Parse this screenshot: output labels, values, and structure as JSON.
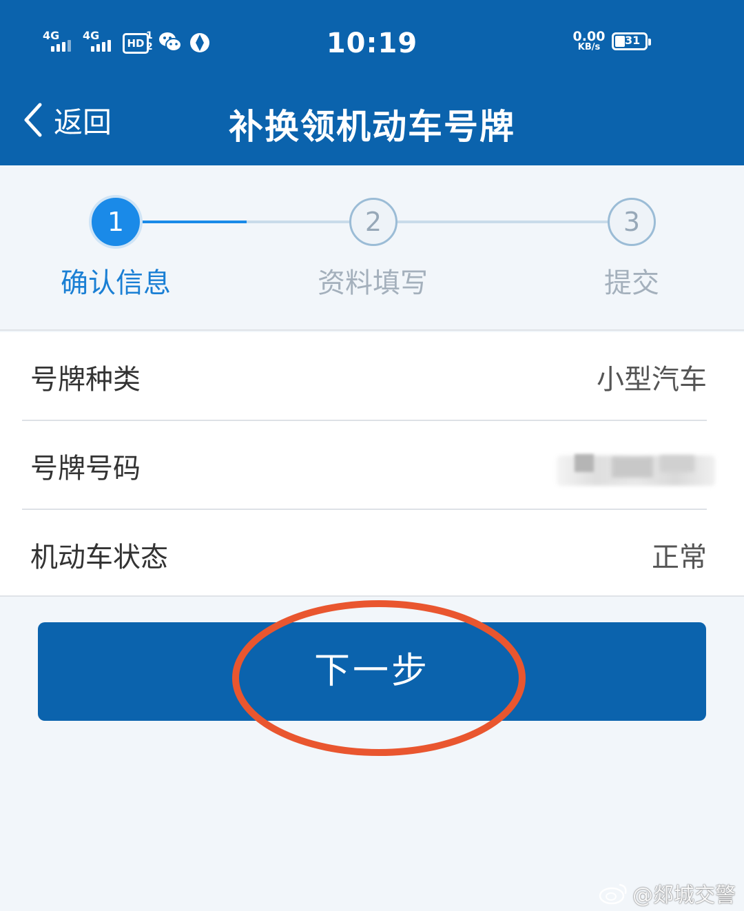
{
  "status_bar": {
    "sim1_label": "4G",
    "sim2_label": "4G",
    "hd_label": "HD",
    "hd_sub_top": "1",
    "hd_sub_bottom": "2",
    "time": "10:19",
    "net_speed_value": "0.00",
    "net_speed_unit": "KB/s",
    "battery_level": "31",
    "icons": [
      "signal-icon",
      "signal-icon",
      "hd-voice-icon",
      "wechat-icon",
      "app-notification-icon",
      "battery-icon"
    ]
  },
  "nav": {
    "back_label": "返回",
    "title": "补换领机动车号牌"
  },
  "steps": [
    {
      "number": "1",
      "label": "确认信息",
      "state": "active"
    },
    {
      "number": "2",
      "label": "资料填写",
      "state": "inactive"
    },
    {
      "number": "3",
      "label": "提交",
      "state": "inactive"
    }
  ],
  "info_rows": [
    {
      "key": "号牌种类",
      "value": "小型汽车"
    },
    {
      "key": "号牌号码",
      "value": ""
    },
    {
      "key": "机动车状态",
      "value": "正常"
    }
  ],
  "next_button_label": "下一步",
  "watermark": "@郯城交警",
  "colors": {
    "header_blue": "#0b63ad",
    "step_active": "#1a8ae8",
    "annotation_red": "#e9562f"
  }
}
